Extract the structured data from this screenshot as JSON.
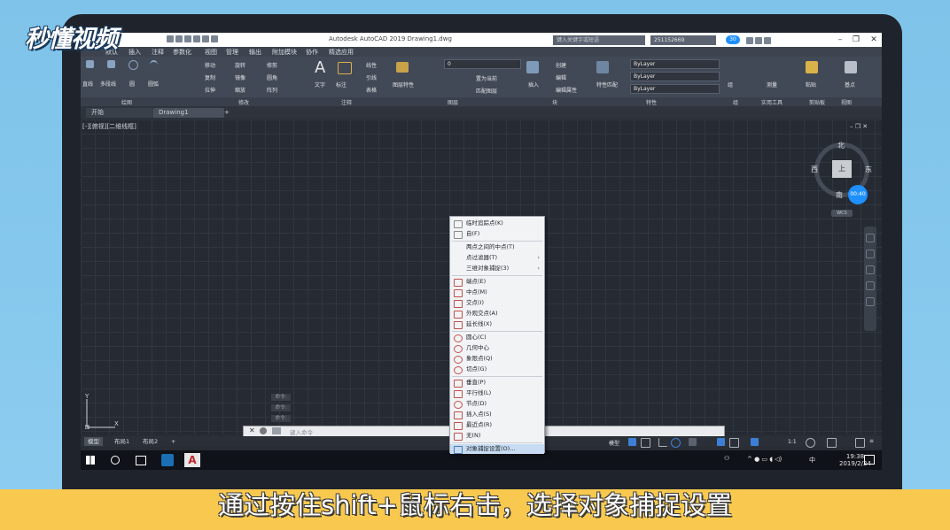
{
  "watermark": "秒懂视频",
  "subtitle": "通过按住shift+鼠标右击，选择对象捕捉设置",
  "window": {
    "title": "Autodesk AutoCAD 2019    Drawing1.dwg",
    "search_placeholder": "键入关键字或短语",
    "user": "251152669",
    "badge": "30"
  },
  "menu_tabs": [
    "默认",
    "插入",
    "注释",
    "参数化",
    "视图",
    "管理",
    "输出",
    "附加模块",
    "协作",
    "精选应用"
  ],
  "ribbon": {
    "tools": [
      "直线",
      "多段线",
      "圆",
      "圆弧",
      "移动",
      "旋转",
      "修剪",
      "复制",
      "镜像",
      "圆角",
      "拉伸",
      "缩放",
      "阵列",
      "文字",
      "标注",
      "线性",
      "引线",
      "表格",
      "图层特性",
      "置为当前",
      "匹配图层",
      "插入",
      "创建",
      "编辑",
      "编辑属性",
      "特性匹配",
      "组",
      "测量",
      "粘贴",
      "基点"
    ],
    "layer_value": "0",
    "bylayer": [
      "ByLayer",
      "ByLayer",
      "ByLayer"
    ],
    "panels": [
      "绘图",
      "修改",
      "注释",
      "图层",
      "块",
      "特性",
      "组",
      "实用工具",
      "剪贴板",
      "视图"
    ]
  },
  "doc_tabs": [
    "开始",
    "Drawing1"
  ],
  "view_label": "[-][俯视][二维线框]",
  "context_menu": {
    "items": [
      {
        "label": "临时追踪点(K)",
        "icon": "track-icon"
      },
      {
        "label": "自(F)",
        "icon": "from-icon"
      },
      {
        "label": "两点之间的中点(T)",
        "icon": ""
      },
      {
        "label": "点过滤器(T)",
        "icon": "",
        "submenu": true
      },
      {
        "label": "三维对象捕捉(3)",
        "icon": "",
        "submenu": true
      },
      {
        "label": "端点(E)",
        "icon": "endpoint-icon"
      },
      {
        "label": "中点(M)",
        "icon": "midpoint-icon"
      },
      {
        "label": "交点(I)",
        "icon": "intersection-icon"
      },
      {
        "label": "外观交点(A)",
        "icon": "apparent-intersection-icon"
      },
      {
        "label": "延长线(X)",
        "icon": "extension-icon"
      },
      {
        "label": "圆心(C)",
        "icon": "center-icon"
      },
      {
        "label": "几何中心",
        "icon": "geometric-center-icon"
      },
      {
        "label": "象限点(Q)",
        "icon": "quadrant-icon"
      },
      {
        "label": "切点(G)",
        "icon": "tangent-icon"
      },
      {
        "label": "垂直(P)",
        "icon": "perpendicular-icon"
      },
      {
        "label": "平行线(L)",
        "icon": "parallel-icon"
      },
      {
        "label": "节点(D)",
        "icon": "node-icon"
      },
      {
        "label": "插入点(S)",
        "icon": "insertion-icon"
      },
      {
        "label": "最近点(R)",
        "icon": "nearest-icon"
      },
      {
        "label": "无(N)",
        "icon": "none-icon"
      },
      {
        "label": "对象捕捉设置(O)...",
        "icon": "osnap-settings-icon",
        "highlighted": true
      }
    ]
  },
  "command_line": {
    "placeholder": "键入命令",
    "history": [
      "命令:",
      "命令:",
      "命令:"
    ]
  },
  "layout_tabs": [
    "模型",
    "布局1",
    "布局2"
  ],
  "status": {
    "model": "模型",
    "scale": "1:1"
  },
  "viewcube": {
    "top": "上",
    "north": "北",
    "south": "南",
    "east": "东",
    "west": "西",
    "wcs": "WCS"
  },
  "taskbar": {
    "time": "19:38",
    "date": "2019/2/24",
    "ime": "中"
  },
  "ucs": {
    "x": "X",
    "y": "Y"
  },
  "colors": {
    "accent": "#f8c94e",
    "highlight": "#c7dcf2",
    "screen": "#272c35"
  }
}
